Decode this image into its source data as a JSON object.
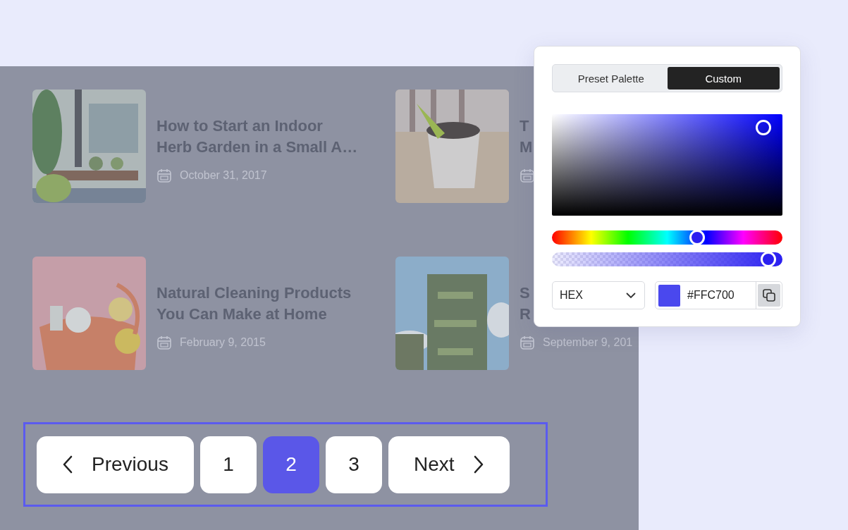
{
  "articles": [
    {
      "title_lines": [
        "How to Start an Indoor",
        "Herb Garden in a Small A…"
      ],
      "date": "October 31, 2017"
    },
    {
      "title_lines": [
        "T",
        "M"
      ]
    },
    {
      "title_lines": [
        "Natural Cleaning Products",
        "You Can Make at Home"
      ],
      "date": "February 9, 2015"
    },
    {
      "title_lines": [
        "S",
        "R"
      ],
      "date": "September 9, 201"
    }
  ],
  "pagination": [
    {
      "kind": "prev",
      "label": "Previous",
      "selected": false
    },
    {
      "kind": "page",
      "label": "1",
      "selected": false
    },
    {
      "kind": "page",
      "label": "2",
      "selected": true
    },
    {
      "kind": "page",
      "label": "3",
      "selected": false
    },
    {
      "kind": "next",
      "label": "Next",
      "selected": false
    }
  ],
  "color_picker": {
    "tabs": [
      {
        "label": "Preset Palette",
        "selected": false
      },
      {
        "label": "Custom",
        "selected": true
      }
    ],
    "hue": {
      "level": 0.63
    },
    "alpha": {
      "level": 0.94
    },
    "format": "HEX",
    "hex_value": "#FFC700"
  }
}
